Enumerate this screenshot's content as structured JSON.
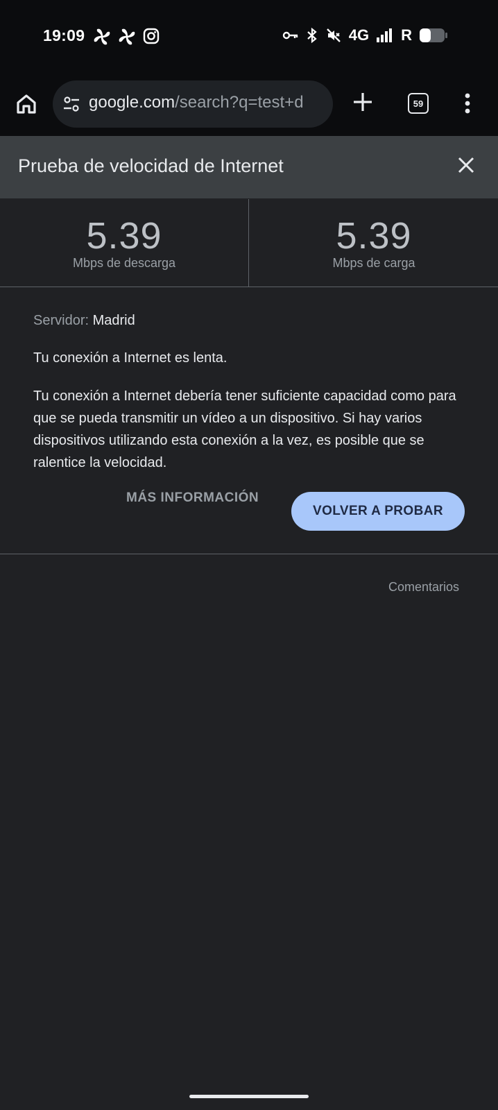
{
  "status_bar": {
    "time": "19:09",
    "network": "4G",
    "left_icons": [
      "pinwheel-icon",
      "pinwheel-icon",
      "instagram-icon"
    ],
    "right_icons": [
      "key-icon",
      "bluetooth-icon",
      "mute-icon",
      "signal-icon",
      "battery-icon"
    ],
    "roaming": "R"
  },
  "browser": {
    "url_host": "google.com",
    "url_path": "/search?q=test+d",
    "tab_count": "59"
  },
  "speed_test": {
    "title": "Prueba de velocidad de Internet",
    "download": {
      "value": "5.39",
      "unit": "Mbps de descarga"
    },
    "upload": {
      "value": "5.39",
      "unit": "Mbps de carga"
    },
    "server_label": "Servidor:",
    "server_value": "Madrid",
    "status_message": "Tu conexión a Internet es lenta.",
    "detail_message": "Tu conexión a Internet debería tener suficiente capacidad como para que se pueda transmitir un vídeo a un dispositivo. Si hay varios dispositivos utilizando esta conexión a la vez, es posible que se ralentice la velocidad.",
    "more_info_label": "MÁS INFORMACIÓN",
    "retry_label": "VOLVER A PROBAR",
    "feedback_label": "Comentarios"
  },
  "colors": {
    "background": "#202124",
    "header": "#3c4043",
    "accent_button": "#a8c7fa",
    "toolbar": "#0b0c0e"
  }
}
